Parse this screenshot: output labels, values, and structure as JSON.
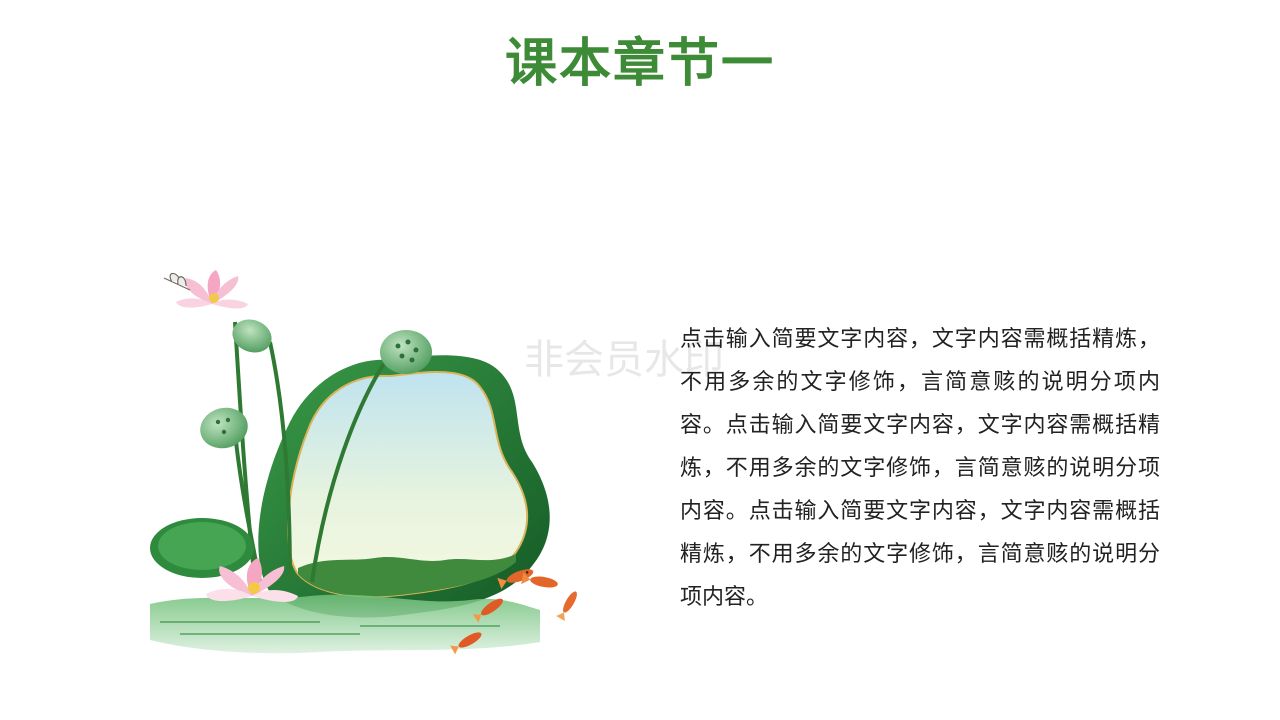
{
  "slide": {
    "title": "课本章节一",
    "body": "点击输入简要文字内容，文字内容需概括精炼，不用多余的文字修饰，言简意赅的说明分项内容。点击输入简要文字内容，文字内容需概括精炼，不用多余的文字修饰，言简意赅的说明分项内容。点击输入简要文字内容，文字内容需概括精炼，不用多余的文字修饰，言简意赅的说明分项内容。",
    "watermark": "非会员水印"
  },
  "colors": {
    "title": "#3d8b37",
    "text": "#222222",
    "leaf_dark": "#1f6b2e",
    "leaf_light": "#4caf50",
    "sky_top": "#cfe9f2",
    "sky_bottom": "#f3f8dc",
    "lotus_pink": "#f4a6c3",
    "koi_orange": "#e2662a"
  },
  "illustration": {
    "icons": [
      "lotus-flower-icon",
      "lotus-seedpod-icon",
      "lotus-leaf-icon",
      "dragonfly-icon",
      "koi-fish-icon"
    ]
  }
}
